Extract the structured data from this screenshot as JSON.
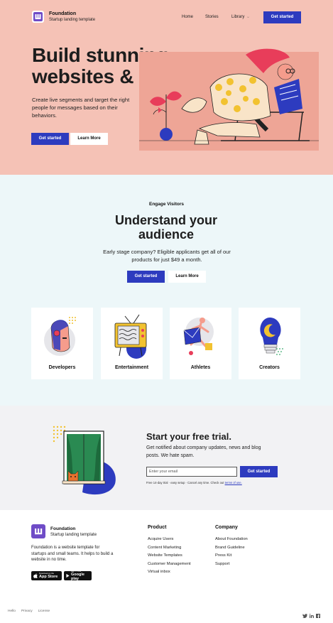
{
  "nav": {
    "brand_name": "Foundation",
    "brand_tagline": "Startup landing template",
    "links": [
      "Home",
      "Stories",
      "Library"
    ],
    "cta": "Get started"
  },
  "hero": {
    "title": "Build stunning websites & apps.",
    "subtitle": "Create live segments and target the right people for messages based on their behaviors.",
    "primary_cta": "Get started",
    "secondary_cta": "Learn More"
  },
  "engage": {
    "eyebrow": "Engage Visitors",
    "title": "Understand your audience",
    "subtitle": "Early stage company? Eligible applicants get all of our products for just $49 a month.",
    "primary_cta": "Get started",
    "secondary_cta": "Learn More",
    "cards": [
      {
        "label": "Developers"
      },
      {
        "label": "Entertainment"
      },
      {
        "label": "Athletes"
      },
      {
        "label": "Creators"
      }
    ]
  },
  "trial": {
    "title": "Start your free trial.",
    "subtitle": "Get notified about company updates, news and blog posts. We hate spam.",
    "email_placeholder": "Enter your email",
    "email_value": "",
    "cta": "Get started",
    "fine_print": "Free 14-day trial · easy setup · Cancel any time. Check out",
    "fine_print_link": "terms of use."
  },
  "footer": {
    "brand_name": "Foundation",
    "brand_tagline": "Startup landing template",
    "description": "Foundation is a website template for startups and small teams. It helps to build a website in no time.",
    "app_store_small": "Download on the",
    "app_store_big": "App Store",
    "google_play_small": "GET IT ON",
    "google_play_big": "Google play",
    "col1_heading": "Product",
    "col1_items": [
      "Acquire Users",
      "Content Marketing",
      "Website Templates",
      "Customer Management",
      "Virtual inbox"
    ],
    "col2_heading": "Company",
    "col2_items": [
      "About Foundation",
      "Brand Guideline",
      "Press Kit",
      "Support"
    ],
    "legal": [
      "Hello",
      "Privacy",
      "License"
    ],
    "social_icons": [
      "twitter-icon",
      "linkedin-icon",
      "facebook-icon"
    ]
  },
  "colors": {
    "accent": "#2d3bbf",
    "hero_bg": "#f5c2b6",
    "engage_bg": "#edf7f9",
    "trial_bg": "#f2f2f4",
    "brand_purple": "#6f4cc7"
  }
}
